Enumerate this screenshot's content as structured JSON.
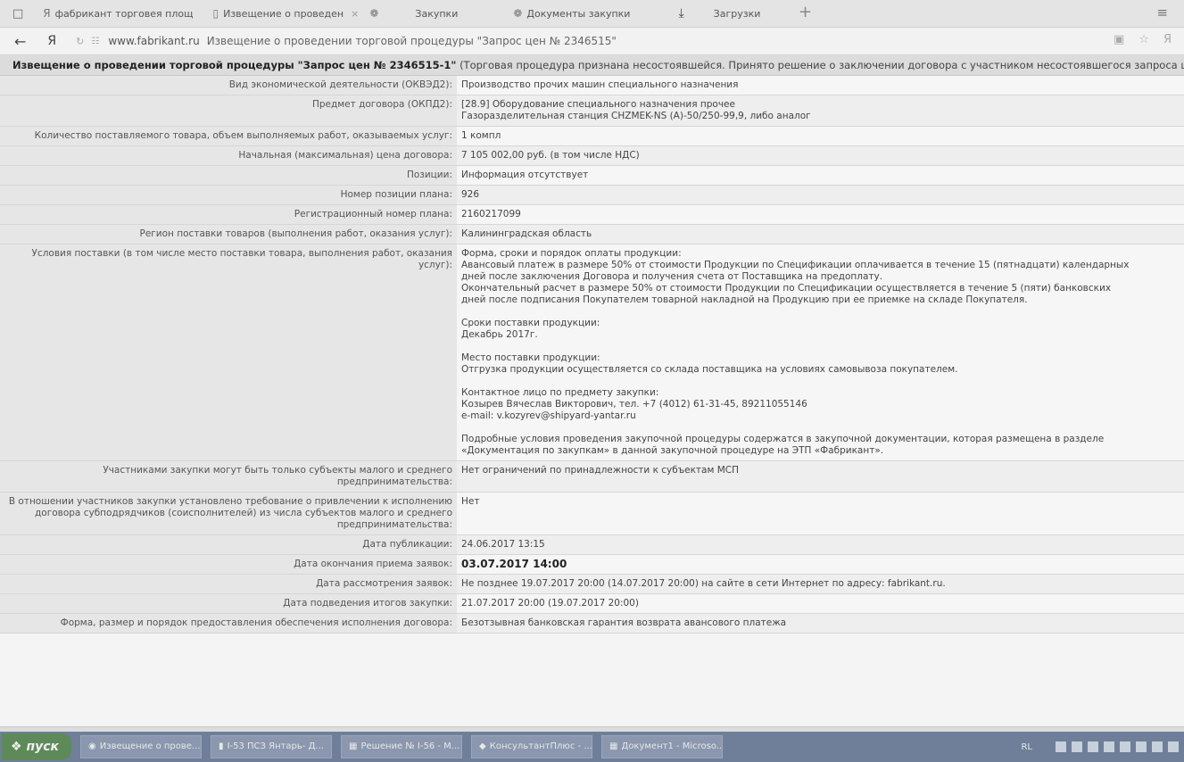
{
  "browser": {
    "tabs": [
      {
        "label": "фабрикант торговея площ",
        "icon": "yandex-icon"
      },
      {
        "label": "Извещение о проведен",
        "icon": "page-icon",
        "close": "×"
      },
      {
        "label": "Закупки",
        "icon": "bookmark-icon"
      },
      {
        "label": "Документы закупки",
        "icon": "bookmark-icon"
      },
      {
        "label": "Загрузки",
        "icon": "download-icon"
      }
    ],
    "new_tab": "+",
    "menu_icon": "≡",
    "address": {
      "yandex_letter": "Я",
      "domain": "www.fabrikant.ru",
      "page_title": "Извещение о проведении торговой процедуры \"Запрос цен № 2346515\""
    }
  },
  "page": {
    "heading_bold": "Извещение о проведении торговой процедуры \"Запрос цен № 2346515-1\"",
    "heading_note": "(Торговая процедура признана несостоявшейся. Принято решение о заключении договора с участником несостоявшегося запроса цен)",
    "rows": [
      {
        "label": "Вид экономической деятельности (ОКВЭД2):",
        "lines": [
          "Производство прочих машин специального назначения"
        ]
      },
      {
        "label": "Предмет договора (ОКПД2):",
        "lines": [
          "[28.9] Оборудование специального назначения прочее",
          "Газоразделительная станция CHZMEK-NS (А)-50/250-99,9, либо аналог"
        ]
      },
      {
        "label": "Количество поставляемого товара, объем выполняемых работ, оказываемых услуг:",
        "lines": [
          "1 компл"
        ]
      },
      {
        "label": "Начальная (максимальная) цена договора:",
        "lines": [
          "7 105 002,00 руб. (в том числе НДС)"
        ]
      },
      {
        "label": "Позиции:",
        "lines": [
          "Информация отсутствует"
        ]
      },
      {
        "label": "Номер позиции плана:",
        "lines": [
          "926"
        ]
      },
      {
        "label": "Регистрационный номер плана:",
        "lines": [
          "2160217099"
        ]
      },
      {
        "label": "Регион поставки товаров (выполнения работ, оказания услуг):",
        "lines": [
          "Калининградская область"
        ]
      },
      {
        "label": "Условия поставки (в том числе место поставки товара, выполнения работ, оказания услуг):",
        "lines": [
          "Форма, сроки и порядок оплаты продукции:",
          "Авансовый платеж в размере 50% от стоимости Продукции по Спецификации оплачивается в течение 15 (пятнадцати) календарных",
          "дней после заключения Договора и получения счета от Поставщика на предоплату.",
          "Окончательный расчет в размере 50% от стоимости Продукции по Спецификации осуществляется в течение 5 (пяти) банковских",
          "дней после подписания Покупателем товарной накладной на Продукцию при ее приемке на складе Покупателя.",
          "",
          "Сроки поставки продукции:",
          "Декабрь 2017г.",
          "",
          "Место поставки продукции:",
          "Отгрузка продукции осуществляется со склада поставщика на условиях самовывоза покупателем.",
          "",
          "Контактное лицо по предмету закупки:",
          "Козырев Вячеслав Викторович, тел. +7 (4012) 61-31-45, 89211055146",
          "e-mail: v.kozyrev@shipyard-yantar.ru",
          "",
          "Подробные условия проведения закупочной процедуры содержатся в закупочной документации, которая размещена в разделе",
          "«Документация по закупкам» в данной закупочной процедуре на ЭТП «Фабрикант»."
        ]
      },
      {
        "label": "Участниками закупки могут быть только субъекты малого и среднего предпринимательства:",
        "lines": [
          "Нет ограничений по принадлежности к субъектам МСП"
        ]
      },
      {
        "label": "В отношении участников закупки установлено требование о привлечении к исполнению договора субподрядчиков (соисполнителей) из числа субъектов малого и среднего предпринимательства:",
        "lines": [
          "Нет"
        ]
      },
      {
        "label": "Дата публикации:",
        "lines": [
          "24.06.2017 13:15"
        ]
      },
      {
        "label": "Дата окончания приема заявок:",
        "lines": [
          "03.07.2017 14:00"
        ],
        "bold": true
      },
      {
        "label": "Дата рассмотрения заявок:",
        "lines": [
          "Не позднее 19.07.2017 20:00 (14.07.2017 20:00) на сайте в сети Интернет по адресу: fabrikant.ru."
        ]
      },
      {
        "label": "Дата подведения итогов закупки:",
        "lines": [
          "21.07.2017 20:00 (19.07.2017 20:00)"
        ]
      },
      {
        "label": "Форма, размер и порядок предоставления обеспечения исполнения договора:",
        "lines": [
          "Безотзывная банковская гарантия возврата авансового платежа"
        ]
      }
    ]
  },
  "taskbar": {
    "start_label": "пуск",
    "items": [
      {
        "label": "Извещение о прове...",
        "icon": "browser-icon"
      },
      {
        "label": "I-53 ПСЗ Янтарь- Д...",
        "icon": "folder-icon"
      },
      {
        "label": "Решение № I-56 - М...",
        "icon": "document-icon"
      },
      {
        "label": "КонсультантПлюс - ...",
        "icon": "app-icon"
      },
      {
        "label": "Документ1 - Microso...",
        "icon": "document-icon"
      }
    ],
    "lang": "RL"
  }
}
